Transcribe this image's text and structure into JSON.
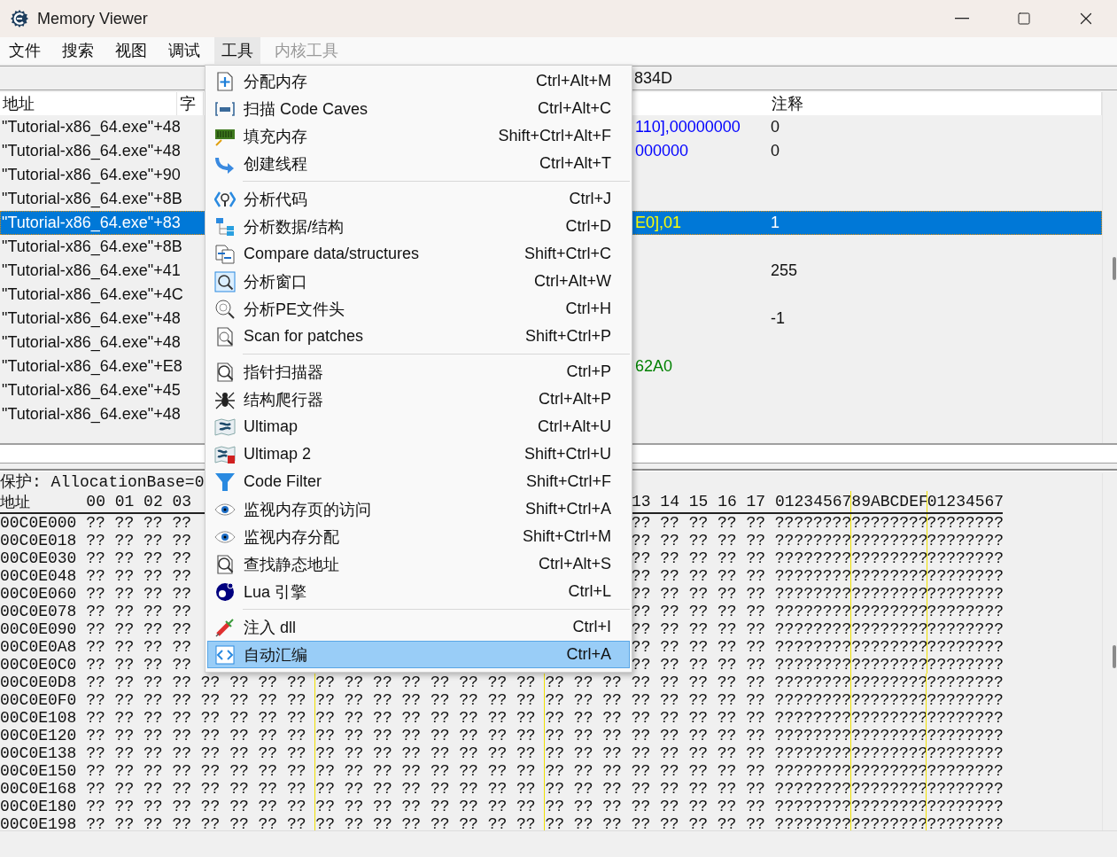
{
  "window": {
    "title": "Memory Viewer"
  },
  "menubar": [
    {
      "label": "文件",
      "selected": false,
      "disabled": false
    },
    {
      "label": "搜索",
      "selected": false,
      "disabled": false
    },
    {
      "label": "视图",
      "selected": false,
      "disabled": false
    },
    {
      "label": "调试",
      "selected": false,
      "disabled": false
    },
    {
      "label": "工具",
      "selected": true,
      "disabled": false
    },
    {
      "label": "内核工具",
      "selected": false,
      "disabled": true
    }
  ],
  "address_bar": {
    "value": "834D"
  },
  "disassembler": {
    "columns": [
      "地址",
      "字",
      "注释"
    ],
    "rows": [
      {
        "address": "\"Tutorial-x86_64.exe\"+48",
        "selected": false,
        "operand": {
          "text": "110],00000000",
          "color": "#0000ff"
        },
        "comment": "0"
      },
      {
        "address": "\"Tutorial-x86_64.exe\"+48",
        "selected": false,
        "operand": {
          "text": "000000",
          "color": "#0000ff"
        },
        "comment": "0"
      },
      {
        "address": "\"Tutorial-x86_64.exe\"+90",
        "selected": false
      },
      {
        "address": "\"Tutorial-x86_64.exe\"+8B",
        "selected": false
      },
      {
        "address": "\"Tutorial-x86_64.exe\"+83",
        "selected": true,
        "operand": {
          "text": "E0],01",
          "color": "#ffff00"
        },
        "comment": "1"
      },
      {
        "address": "\"Tutorial-x86_64.exe\"+8B",
        "selected": false
      },
      {
        "address": "\"Tutorial-x86_64.exe\"+41",
        "selected": false,
        "comment": "255"
      },
      {
        "address": "\"Tutorial-x86_64.exe\"+4C",
        "selected": false
      },
      {
        "address": "\"Tutorial-x86_64.exe\"+48",
        "selected": false,
        "comment": "-1"
      },
      {
        "address": "\"Tutorial-x86_64.exe\"+48",
        "selected": false
      },
      {
        "address": "\"Tutorial-x86_64.exe\"+E8",
        "selected": false,
        "operand": {
          "text": "62A0",
          "color": "#008000"
        }
      },
      {
        "address": "\"Tutorial-x86_64.exe\"+45",
        "selected": false
      },
      {
        "address": "\"Tutorial-x86_64.exe\"+48",
        "selected": false
      }
    ]
  },
  "hex_view": {
    "info": "保护: AllocationBase=0",
    "header": {
      "address": "地址",
      "columns_before": [
        "00",
        "01",
        "02",
        "03"
      ],
      "columns_after": [
        "13",
        "14",
        "15",
        "16",
        "17"
      ],
      "ascii": [
        "01234567",
        "89ABCDEF",
        "01234567"
      ]
    },
    "rows": [
      {
        "address": "00C0E000",
        "bytes_before": [
          "??",
          "??",
          "??",
          "??"
        ],
        "bytes_after": [
          "??",
          "??",
          "??",
          "??",
          "??"
        ],
        "ascii": [
          "????????",
          "????????",
          "????????"
        ]
      },
      {
        "address": "00C0E018",
        "bytes_before": [
          "??",
          "??",
          "??",
          "??"
        ],
        "bytes_after": [
          "??",
          "??",
          "??",
          "??",
          "??"
        ],
        "ascii": [
          "????????",
          "????????",
          "????????"
        ]
      },
      {
        "address": "00C0E030",
        "bytes_before": [
          "??",
          "??",
          "??",
          "??"
        ],
        "bytes_after": [
          "??",
          "??",
          "??",
          "??",
          "??"
        ],
        "ascii": [
          "????????",
          "????????",
          "????????"
        ]
      },
      {
        "address": "00C0E048",
        "bytes_before": [
          "??",
          "??",
          "??",
          "??"
        ],
        "bytes_after": [
          "??",
          "??",
          "??",
          "??",
          "??"
        ],
        "ascii": [
          "????????",
          "????????",
          "????????"
        ]
      },
      {
        "address": "00C0E060",
        "bytes_before": [
          "??",
          "??",
          "??",
          "??"
        ],
        "bytes_after": [
          "??",
          "??",
          "??",
          "??",
          "??"
        ],
        "ascii": [
          "????????",
          "????????",
          "????????"
        ]
      },
      {
        "address": "00C0E078",
        "bytes_before": [
          "??",
          "??",
          "??",
          "??"
        ],
        "bytes_after": [
          "??",
          "??",
          "??",
          "??",
          "??"
        ],
        "ascii": [
          "????????",
          "????????",
          "????????"
        ]
      },
      {
        "address": "00C0E090",
        "bytes_before": [
          "??",
          "??",
          "??",
          "??"
        ],
        "bytes_after": [
          "??",
          "??",
          "??",
          "??",
          "??"
        ],
        "ascii": [
          "????????",
          "????????",
          "????????"
        ]
      },
      {
        "address": "00C0E0A8",
        "bytes_before": [
          "??",
          "??",
          "??",
          "??"
        ],
        "bytes_after": [
          "??",
          "??",
          "??",
          "??",
          "??"
        ],
        "ascii": [
          "????????",
          "????????",
          "????????"
        ]
      },
      {
        "address": "00C0E0C0",
        "bytes_before": [
          "??",
          "??",
          "??",
          "??"
        ],
        "bytes_after": [
          "??",
          "??",
          "??",
          "??",
          "??"
        ],
        "ascii": [
          "????????",
          "????????",
          "????????"
        ]
      },
      {
        "address": "00C0E0D8",
        "bytes": [
          "??",
          "??",
          "??",
          "??",
          "??",
          "??",
          "??",
          "??",
          "??",
          "??",
          "??",
          "??",
          "??",
          "??",
          "??",
          "??",
          "??",
          "??",
          "??",
          "??",
          "??",
          "??",
          "??",
          "??"
        ],
        "ascii": [
          "????????",
          "????????",
          "????????"
        ]
      },
      {
        "address": "00C0E0F0",
        "bytes": [
          "??",
          "??",
          "??",
          "??",
          "??",
          "??",
          "??",
          "??",
          "??",
          "??",
          "??",
          "??",
          "??",
          "??",
          "??",
          "??",
          "??",
          "??",
          "??",
          "??",
          "??",
          "??",
          "??",
          "??"
        ],
        "ascii": [
          "????????",
          "????????",
          "????????"
        ]
      },
      {
        "address": "00C0E108",
        "bytes": [
          "??",
          "??",
          "??",
          "??",
          "??",
          "??",
          "??",
          "??",
          "??",
          "??",
          "??",
          "??",
          "??",
          "??",
          "??",
          "??",
          "??",
          "??",
          "??",
          "??",
          "??",
          "??",
          "??",
          "??"
        ],
        "ascii": [
          "????????",
          "????????",
          "????????"
        ]
      },
      {
        "address": "00C0E120",
        "bytes": [
          "??",
          "??",
          "??",
          "??",
          "??",
          "??",
          "??",
          "??",
          "??",
          "??",
          "??",
          "??",
          "??",
          "??",
          "??",
          "??",
          "??",
          "??",
          "??",
          "??",
          "??",
          "??",
          "??",
          "??"
        ],
        "ascii": [
          "????????",
          "????????",
          "????????"
        ]
      },
      {
        "address": "00C0E138",
        "bytes": [
          "??",
          "??",
          "??",
          "??",
          "??",
          "??",
          "??",
          "??",
          "??",
          "??",
          "??",
          "??",
          "??",
          "??",
          "??",
          "??",
          "??",
          "??",
          "??",
          "??",
          "??",
          "??",
          "??",
          "??"
        ],
        "ascii": [
          "????????",
          "????????",
          "????????"
        ]
      },
      {
        "address": "00C0E150",
        "bytes": [
          "??",
          "??",
          "??",
          "??",
          "??",
          "??",
          "??",
          "??",
          "??",
          "??",
          "??",
          "??",
          "??",
          "??",
          "??",
          "??",
          "??",
          "??",
          "??",
          "??",
          "??",
          "??",
          "??",
          "??"
        ],
        "ascii": [
          "????????",
          "????????",
          "????????"
        ]
      },
      {
        "address": "00C0E168",
        "bytes": [
          "??",
          "??",
          "??",
          "??",
          "??",
          "??",
          "??",
          "??",
          "??",
          "??",
          "??",
          "??",
          "??",
          "??",
          "??",
          "??",
          "??",
          "??",
          "??",
          "??",
          "??",
          "??",
          "??",
          "??"
        ],
        "ascii": [
          "????????",
          "????????",
          "????????"
        ]
      },
      {
        "address": "00C0E180",
        "bytes": [
          "??",
          "??",
          "??",
          "??",
          "??",
          "??",
          "??",
          "??",
          "??",
          "??",
          "??",
          "??",
          "??",
          "??",
          "??",
          "??",
          "??",
          "??",
          "??",
          "??",
          "??",
          "??",
          "??",
          "??"
        ],
        "ascii": [
          "????????",
          "????????",
          "????????"
        ]
      },
      {
        "address": "00C0E198",
        "bytes": [
          "??",
          "??",
          "??",
          "??",
          "??",
          "??",
          "??",
          "??",
          "??",
          "??",
          "??",
          "??",
          "??",
          "??",
          "??",
          "??",
          "??",
          "??",
          "??",
          "??",
          "??",
          "??",
          "??",
          "??"
        ],
        "ascii": [
          "????????",
          "????????",
          "????????"
        ]
      }
    ]
  },
  "tools_menu": [
    {
      "kind": "item",
      "label": "分配内存",
      "shortcut": "Ctrl+Alt+M",
      "selected": false
    },
    {
      "kind": "item",
      "label": "扫描 Code Caves",
      "shortcut": "Ctrl+Alt+C",
      "selected": false
    },
    {
      "kind": "item",
      "label": "填充内存",
      "shortcut": "Shift+Ctrl+Alt+F",
      "selected": false
    },
    {
      "kind": "item",
      "label": "创建线程",
      "shortcut": "Ctrl+Alt+T",
      "selected": false
    },
    {
      "kind": "separator"
    },
    {
      "kind": "item",
      "label": "分析代码",
      "shortcut": "Ctrl+J",
      "selected": false
    },
    {
      "kind": "item",
      "label": "分析数据/结构",
      "shortcut": "Ctrl+D",
      "selected": false
    },
    {
      "kind": "item",
      "label": "Compare data/structures",
      "shortcut": "Shift+Ctrl+C",
      "selected": false
    },
    {
      "kind": "item",
      "label": "分析窗口",
      "shortcut": "Ctrl+Alt+W",
      "selected": false
    },
    {
      "kind": "item",
      "label": "分析PE文件头",
      "shortcut": "Ctrl+H",
      "selected": false
    },
    {
      "kind": "item",
      "label": "Scan for patches",
      "shortcut": "Shift+Ctrl+P",
      "selected": false
    },
    {
      "kind": "separator"
    },
    {
      "kind": "item",
      "label": "指针扫描器",
      "shortcut": "Ctrl+P",
      "selected": false
    },
    {
      "kind": "item",
      "label": "结构爬行器",
      "shortcut": "Ctrl+Alt+P",
      "selected": false
    },
    {
      "kind": "item",
      "label": "Ultimap",
      "shortcut": "Ctrl+Alt+U",
      "selected": false
    },
    {
      "kind": "item",
      "label": "Ultimap 2",
      "shortcut": "Shift+Ctrl+U",
      "selected": false
    },
    {
      "kind": "item",
      "label": "Code Filter",
      "shortcut": "Shift+Ctrl+F",
      "selected": false
    },
    {
      "kind": "item",
      "label": "监视内存页的访问",
      "shortcut": "Shift+Ctrl+A",
      "selected": false
    },
    {
      "kind": "item",
      "label": "监视内存分配",
      "shortcut": "Shift+Ctrl+M",
      "selected": false
    },
    {
      "kind": "item",
      "label": "查找静态地址",
      "shortcut": "Ctrl+Alt+S",
      "selected": false
    },
    {
      "kind": "item",
      "label": "Lua 引擎",
      "shortcut": "Ctrl+L",
      "selected": false
    },
    {
      "kind": "separator"
    },
    {
      "kind": "item",
      "label": "注入 dll",
      "shortcut": "Ctrl+I",
      "selected": false
    },
    {
      "kind": "item",
      "label": "自动汇编",
      "shortcut": "Ctrl+A",
      "selected": true
    }
  ]
}
